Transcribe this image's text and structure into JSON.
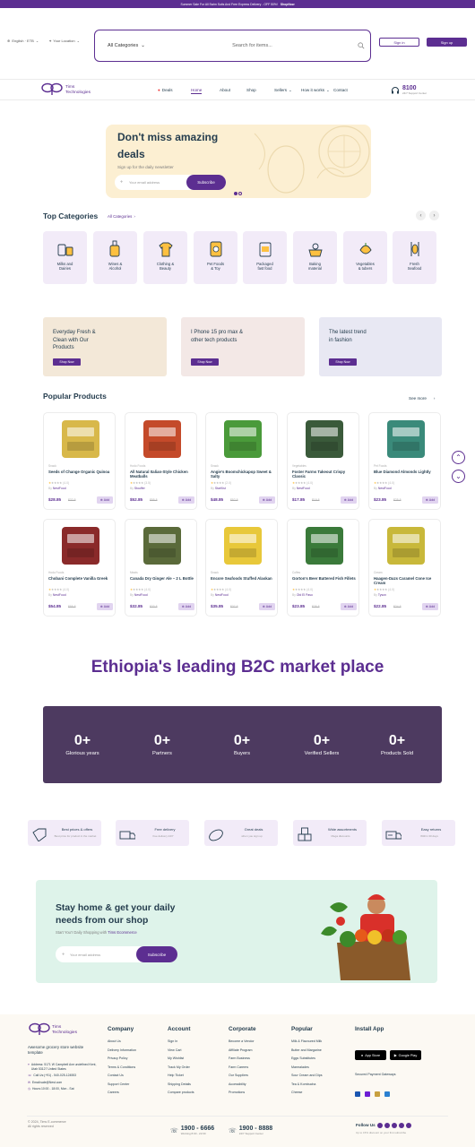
{
  "topbar": {
    "text": "Summer Sale For All Swim Suits And Free Express Delivery - OFF 50%!",
    "cta": "ShopNow"
  },
  "header": {
    "language": "English · ETB",
    "location": "Your Location",
    "search_category": "All Categories",
    "search_placeholder": "Search for items...",
    "sign_in": "Sign in",
    "sign_up": "Sign up"
  },
  "nav": {
    "logo_line1": "Tims",
    "logo_line2": "Technologies",
    "deals": "Deals",
    "home": "Home",
    "about": "About",
    "shop": "Shop",
    "sellers": "Sellers",
    "how": "How it works",
    "contact": "Contact",
    "phone": "8100",
    "support": "24/7 Support Center"
  },
  "hero": {
    "title_line1": "Don't miss amazing",
    "title_line2": "deals",
    "subtitle": "Sign up for the daily newsletter",
    "email_placeholder": "Your email address",
    "button": "Subscribe"
  },
  "top_categories": {
    "title": "Top Categories",
    "all": "All Categories",
    "items": [
      {
        "label1": "Milks and",
        "label2": "Dairies",
        "icon": "milk-icon"
      },
      {
        "label1": "Wines &",
        "label2": "Alcohol",
        "icon": "wine-icon"
      },
      {
        "label1": "Clothing &",
        "label2": "Beauty",
        "icon": "clothing-icon"
      },
      {
        "label1": "Pet Foods",
        "label2": "& Toy",
        "icon": "pet-food-icon"
      },
      {
        "label1": "Packaged",
        "label2": "fast food",
        "icon": "packaged-food-icon"
      },
      {
        "label1": "Baking",
        "label2": "material",
        "icon": "baking-icon"
      },
      {
        "label1": "Vegetables",
        "label2": "& tubers",
        "icon": "vegetables-icon"
      },
      {
        "label1": "Fresh",
        "label2": "Seafood",
        "icon": "seafood-icon"
      }
    ]
  },
  "promos": [
    {
      "line1": "Everyday Fresh &",
      "line2": "Clean with Our",
      "line3": "Products",
      "button": "Shop Now",
      "bg": "#f3e8d8"
    },
    {
      "line1": "I Phone 15 pro max &",
      "line2": "other tech products",
      "line3": "",
      "button": "Shop Now",
      "bg": "#f3e8e6"
    },
    {
      "line1": "The latest trend",
      "line2": "in fashion",
      "line3": "",
      "button": "Shop Now",
      "bg": "#e8e8f3"
    }
  ],
  "popular": {
    "title": "Popular Products",
    "see_more": "See more",
    "add_label": "Add",
    "by_label": "By",
    "products": [
      {
        "category": "Snack",
        "name": "Seeds of Change Organic Quinoa",
        "rating": "(4.0)",
        "vendor": "NestFood",
        "price": "$28.85",
        "old": "$32.8",
        "color": "#d8b84a"
      },
      {
        "category": "Hodo Foods",
        "name": "All Natural Italian-Style Chicken Meatballs",
        "rating": "(3.5)",
        "vendor": "Stouffer",
        "price": "$52.85",
        "old": "$55.8",
        "color": "#c44a2a"
      },
      {
        "category": "Snack",
        "name": "Angie's Boomchickapop Sweet & Salty",
        "rating": "(2.0)",
        "vendor": "StarKist",
        "price": "$48.85",
        "old": "$52.8",
        "color": "#4a9a3a"
      },
      {
        "category": "Vegetables",
        "name": "Foster Farms Takeout Crispy Classic",
        "rating": "(4.0)",
        "vendor": "NestFood",
        "price": "$17.85",
        "old": "$19.8",
        "color": "#3a5a3a"
      },
      {
        "category": "Pet Foods",
        "name": "Blue Diamond Almonds Lightly",
        "rating": "(4.0)",
        "vendor": "NestFood",
        "price": "$23.85",
        "old": "$25.8",
        "color": "#3a8a7a"
      },
      {
        "category": "Hodo Foods",
        "name": "Chobani Complete Vanilla Greek",
        "rating": "(4.0)",
        "vendor": "NestFood",
        "price": "$54.85",
        "old": "$55.8",
        "color": "#8a2a2a"
      },
      {
        "category": "Meats",
        "name": "Canada Dry Ginger Ale – 2 L Bottle",
        "rating": "(4.0)",
        "vendor": "NestFood",
        "price": "$32.85",
        "old": "$33.8",
        "color": "#5a6a3a"
      },
      {
        "category": "Snack",
        "name": "Encore Seafoods Stuffed Alaskan",
        "rating": "(4.0)",
        "vendor": "NestFood",
        "price": "$35.85",
        "old": "$37.8",
        "color": "#e8c83a"
      },
      {
        "category": "Coffes",
        "name": "Gorton's Beer Battered Fish Fillets",
        "rating": "(4.0)",
        "vendor": "Old El Paso",
        "price": "$23.85",
        "old": "$25.8",
        "color": "#3a7a3a"
      },
      {
        "category": "Cream",
        "name": "Haagen-Dazs Caramel Cone Ice Cream",
        "rating": "(4.0)",
        "vendor": "Tyson",
        "price": "$22.85",
        "old": "$24.8",
        "color": "#c8b83a"
      }
    ]
  },
  "marketplace_title": "Ethiopia's leading B2C market place",
  "stats": [
    {
      "value": "0+",
      "label": "Glorious years"
    },
    {
      "value": "0+",
      "label": "Partners"
    },
    {
      "value": "0+",
      "label": "Buyers"
    },
    {
      "value": "0+",
      "label": "Verified Sellers"
    },
    {
      "value": "0+",
      "label": "Products Sold"
    }
  ],
  "features": [
    {
      "title": "Best prices & offers",
      "sub": "Best price for product in the market",
      "icon": "price-tag-icon"
    },
    {
      "title": "Free delivery",
      "sub": "free delivery 24/7",
      "icon": "truck-icon"
    },
    {
      "title": "Great deals",
      "sub": "when you sign up",
      "icon": "deal-icon"
    },
    {
      "title": "Wide assortments",
      "sub": "Mega discounts",
      "icon": "boxes-icon"
    },
    {
      "title": "Easy returns",
      "sub": "Within 30 days",
      "icon": "return-truck-icon"
    }
  ],
  "stay_home": {
    "title_line1": "Stay home & get your daily",
    "title_line2": "needs from our shop",
    "sub_prefix": "Start You'r Daily Shopping with",
    "sub_brand": "Tims Ecommerce",
    "email_placeholder": "Your email address",
    "button": "Subscribe"
  },
  "footer": {
    "logo_line1": "Tims",
    "logo_line2": "Technologies",
    "tagline": "Awesome grocery store website template",
    "address": "Address: 5171 W Campbell Ave undefined Kent, Utah 53127 United States",
    "call": "Call Us:(+91) - 540-025-124553",
    "email": "Email:sale@Nest.com",
    "hours": "Hours:10:00 - 18:00, Mon - Sat",
    "columns": [
      {
        "title": "Company",
        "items": [
          "About Us",
          "Delivery Information",
          "Privacy Policy",
          "Terms & Conditions",
          "Contact Us",
          "Support Center",
          "Careers"
        ]
      },
      {
        "title": "Account",
        "items": [
          "Sign In",
          "View Cart",
          "My Wishlist",
          "Track My Order",
          "Help Ticket",
          "Shipping Details",
          "Compare products"
        ]
      },
      {
        "title": "Corporate",
        "items": [
          "Become a Vendor",
          "Affiliate Program",
          "Farm Business",
          "Farm Careers",
          "Our Suppliers",
          "Accessibility",
          "Promotions"
        ]
      },
      {
        "title": "Popular",
        "items": [
          "Milk & Flavoured Milk",
          "Butter and Margarine",
          "Eggs Substitutes",
          "Marmalades",
          "Sour Cream and Dips",
          "Tea & Kombucha",
          "Cheese"
        ]
      }
    ],
    "install_title": "Install App",
    "app_store": "App Store",
    "google_play": "Google Play",
    "secured": "Secured Payment Gateways",
    "copyright": "© 2024, Tims E-commerce",
    "rights": "All rights reserved",
    "phone1": "1900 - 6666",
    "phone1_sub": "Working 8:00 - 22:00",
    "phone2": "1900 - 8888",
    "phone2_sub": "24/7 Support Center",
    "follow": "Follow Us",
    "discount": "Up to 15% discount on your first subscribe"
  }
}
